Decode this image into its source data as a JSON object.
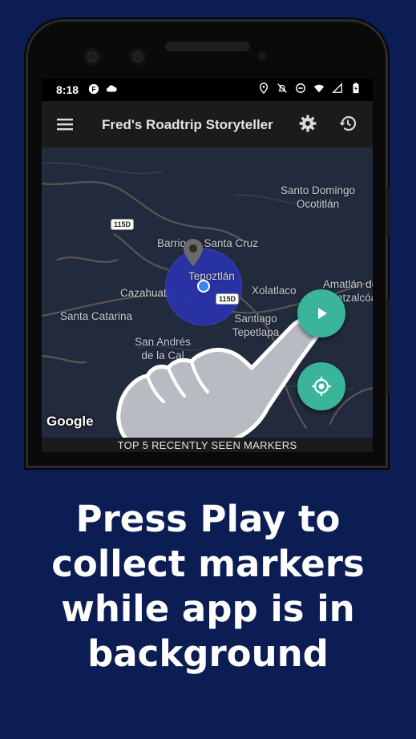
{
  "status_bar": {
    "time": "8:18"
  },
  "app_bar": {
    "title": "Fred's Roadtrip Storyteller",
    "menu_icon": "hamburger-menu-icon",
    "settings_icon": "gear-icon",
    "history_icon": "history-icon"
  },
  "map": {
    "places": [
      "Santo Domingo Ocotitlán",
      "Barrio de Santa Cruz",
      "Tepoztlán",
      "Xolatlaco",
      "Cazahuatla",
      "Santa Catarina",
      "Santiago Tepetlapa",
      "San Andrés de la Cal",
      "Amatlán de Quetzalcóatl"
    ],
    "highway_shields": [
      "115D",
      "115D"
    ],
    "attribution": "Google"
  },
  "controls": {
    "play_icon": "play-icon",
    "locate_icon": "my-location-icon"
  },
  "bottom_sheet": {
    "label": "TOP 5 RECENTLY SEEN MARKERS"
  },
  "caption": {
    "line1": "Press Play to",
    "line2": "collect markers",
    "line3": "while app is in",
    "line4": "background"
  },
  "colors": {
    "background": "#0b1d52",
    "accent": "#3bb59a",
    "circle": "#2a33a8"
  }
}
